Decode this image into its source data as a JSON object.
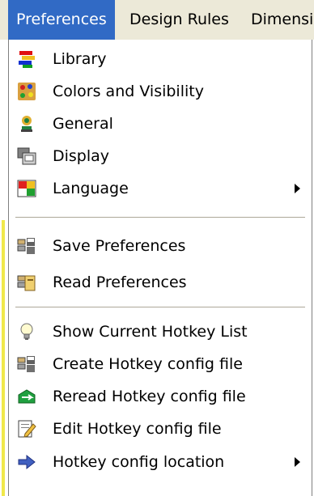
{
  "menubar": {
    "items": [
      {
        "label": "Preferences"
      },
      {
        "label": "Design Rules"
      },
      {
        "label": "Dimensio"
      }
    ]
  },
  "menu": {
    "items": [
      {
        "label": "Library",
        "icon": "library-icon",
        "submenu": false
      },
      {
        "label": "Colors and Visibility",
        "icon": "palette-icon",
        "submenu": false
      },
      {
        "label": "General",
        "icon": "general-icon",
        "submenu": false
      },
      {
        "label": "Display",
        "icon": "display-icon",
        "submenu": false
      },
      {
        "label": "Language",
        "icon": "language-icon",
        "submenu": true
      },
      {
        "label": "Save Preferences",
        "icon": "save-preferences-icon",
        "submenu": false
      },
      {
        "label": "Read Preferences",
        "icon": "read-preferences-icon",
        "submenu": false
      },
      {
        "label": "Show Current Hotkey List",
        "icon": "lightbulb-icon",
        "submenu": false
      },
      {
        "label": "Create Hotkey config file",
        "icon": "create-config-icon",
        "submenu": false
      },
      {
        "label": "Reread Hotkey config file",
        "icon": "reread-icon",
        "submenu": false
      },
      {
        "label": "Edit Hotkey config file",
        "icon": "edit-icon",
        "submenu": false
      },
      {
        "label": "Hotkey config location",
        "icon": "arrow-right-icon",
        "submenu": true
      }
    ]
  },
  "colors": {
    "menubar_bg": "#ece9d8",
    "highlight": "#316ac5",
    "highlight_text": "#ffffff",
    "separator": "#aca899",
    "accent_strip": "#f0e84a"
  }
}
